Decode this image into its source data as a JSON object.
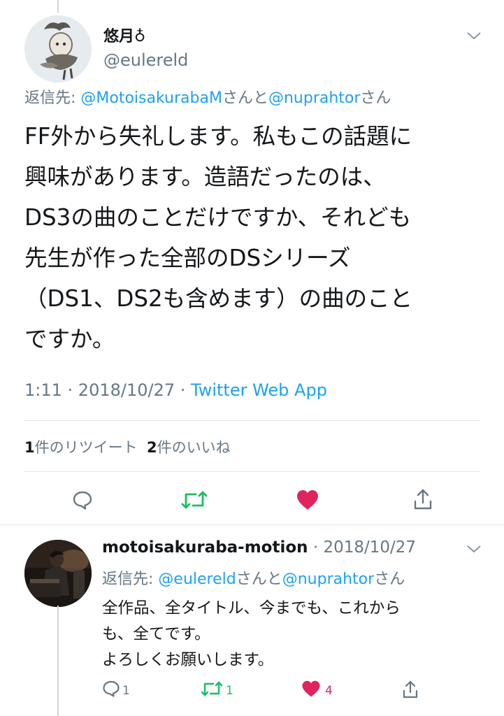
{
  "main_tweet": {
    "display_name": "悠月",
    "display_name_emoji": "♁",
    "handle": "@eulereld",
    "replying_prefix": "返信先: ",
    "replying_mention_1": "@MotoisakurabaM",
    "replying_connector": "さんと",
    "replying_mention_2": "@nuprahtor",
    "replying_suffix": "さん",
    "text_lines": [
      "FF外から失礼します。私もこの話題に",
      "興味があります。造語だったのは、",
      "DS3の曲のことだけですか、それども",
      "先生が作った全部のDSシリーズ",
      "（DS1、DS2も含めます）の曲のこと",
      "ですか。"
    ],
    "time": "1:11",
    "date": "2018/10/27",
    "separator": " · ",
    "source": "Twitter Web App",
    "retweet_count": "1",
    "retweet_label": "件のリツイート",
    "like_count": "2",
    "like_label": "件のいいね"
  },
  "reply_tweet": {
    "display_name": "motoisakuraba-motion",
    "separator": " · ",
    "date": "2018/10/27",
    "replying_prefix": "返信先: ",
    "replying_mention_1": "@eulereld",
    "replying_connector": "さんと",
    "replying_mention_2": "@nuprahtor",
    "replying_suffix": "さん",
    "text_lines": [
      "全作品、全タイトル、今までも、これから",
      "も、全てです。",
      "よろしくお願いします。"
    ],
    "reply_count": "1",
    "retweet_count": "1",
    "like_count": "4"
  },
  "icons": {
    "reply": "comment-icon",
    "retweet": "retweet-icon",
    "like": "heart-icon",
    "share": "share-icon",
    "menu": "chevron-down-icon"
  },
  "colors": {
    "accent": "#1da1f2",
    "retweet_green": "#17bf63",
    "like_red": "#e0245e",
    "secondary_text": "#657786"
  }
}
